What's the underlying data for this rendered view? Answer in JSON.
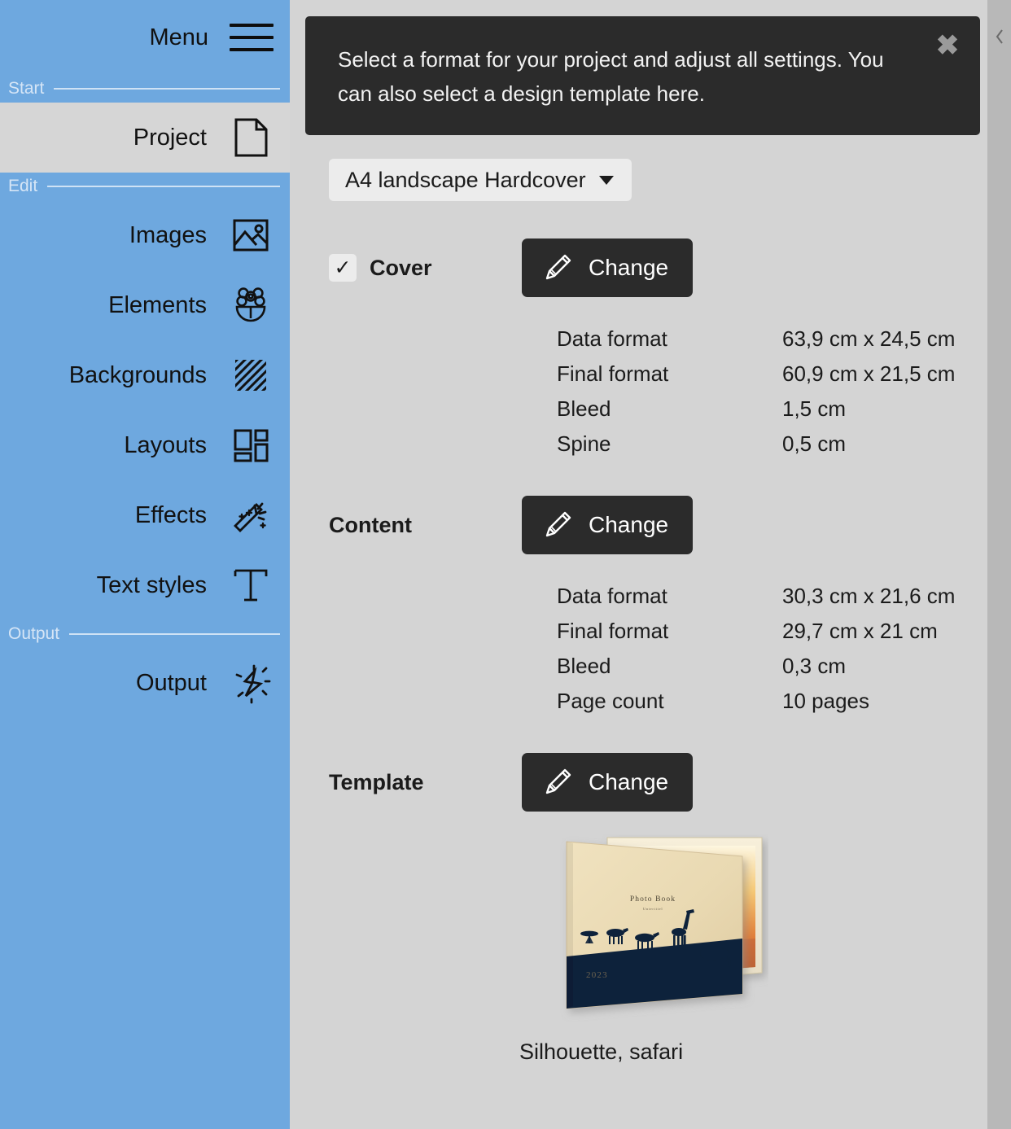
{
  "sidebar": {
    "menu_label": "Menu",
    "menu_icon": "hamburger-icon",
    "sections": [
      {
        "label": "Start",
        "items": [
          {
            "label": "Project",
            "icon": "document-icon",
            "active": true
          }
        ]
      },
      {
        "label": "Edit",
        "items": [
          {
            "label": "Images",
            "icon": "image-icon",
            "active": false
          },
          {
            "label": "Elements",
            "icon": "flower-icon",
            "active": false
          },
          {
            "label": "Backgrounds",
            "icon": "hatch-pattern-icon",
            "active": false
          },
          {
            "label": "Layouts",
            "icon": "layout-grid-icon",
            "active": false
          },
          {
            "label": "Effects",
            "icon": "magic-wand-icon",
            "active": false
          },
          {
            "label": "Text styles",
            "icon": "text-T-icon",
            "active": false
          }
        ]
      },
      {
        "label": "Output",
        "items": [
          {
            "label": "Output",
            "icon": "burst-star-icon",
            "active": false
          }
        ]
      }
    ]
  },
  "tooltip": {
    "text": "Select a format for your project and adjust all settings. You can also select a design template here.",
    "close_icon": "close-icon",
    "close_glyph": "✖"
  },
  "format_select": {
    "value": "A4 landscape Hardcover",
    "caret_icon": "chevron-down-icon"
  },
  "sections": {
    "cover": {
      "title": "Cover",
      "checked": true,
      "check_glyph": "✓",
      "change_label": "Change",
      "specs": [
        {
          "key": "Data format",
          "value": "63,9 cm x 24,5 cm"
        },
        {
          "key": "Final format",
          "value": "60,9 cm x 21,5 cm"
        },
        {
          "key": "Bleed",
          "value": "1,5 cm"
        },
        {
          "key": "Spine",
          "value": "0,5 cm"
        }
      ]
    },
    "content": {
      "title": "Content",
      "change_label": "Change",
      "specs": [
        {
          "key": "Data format",
          "value": "30,3 cm x 21,6 cm"
        },
        {
          "key": "Final format",
          "value": "29,7 cm x 21 cm"
        },
        {
          "key": "Bleed",
          "value": "0,3 cm"
        },
        {
          "key": "Page count",
          "value": "10 pages"
        }
      ]
    },
    "template": {
      "title": "Template",
      "change_label": "Change",
      "preview_title": "Photo Book",
      "preview_subtitle": "Untertitel",
      "preview_year": "2023",
      "name": "Silhouette, safari"
    }
  },
  "right_rail": {
    "collapse_icon": "chevron-left-icon"
  },
  "colors": {
    "sidebar_blue": "#6ea8df",
    "main_bg": "#d4d4d4",
    "active_item_bg": "#d6d6d6",
    "dark_panel": "#2b2b2b",
    "right_rail": "#b8b8b8",
    "text_dark": "#1b1b1b",
    "section_label": "#d5e5f6",
    "book_paper": "#edddb8",
    "book_band": "#11213a"
  }
}
